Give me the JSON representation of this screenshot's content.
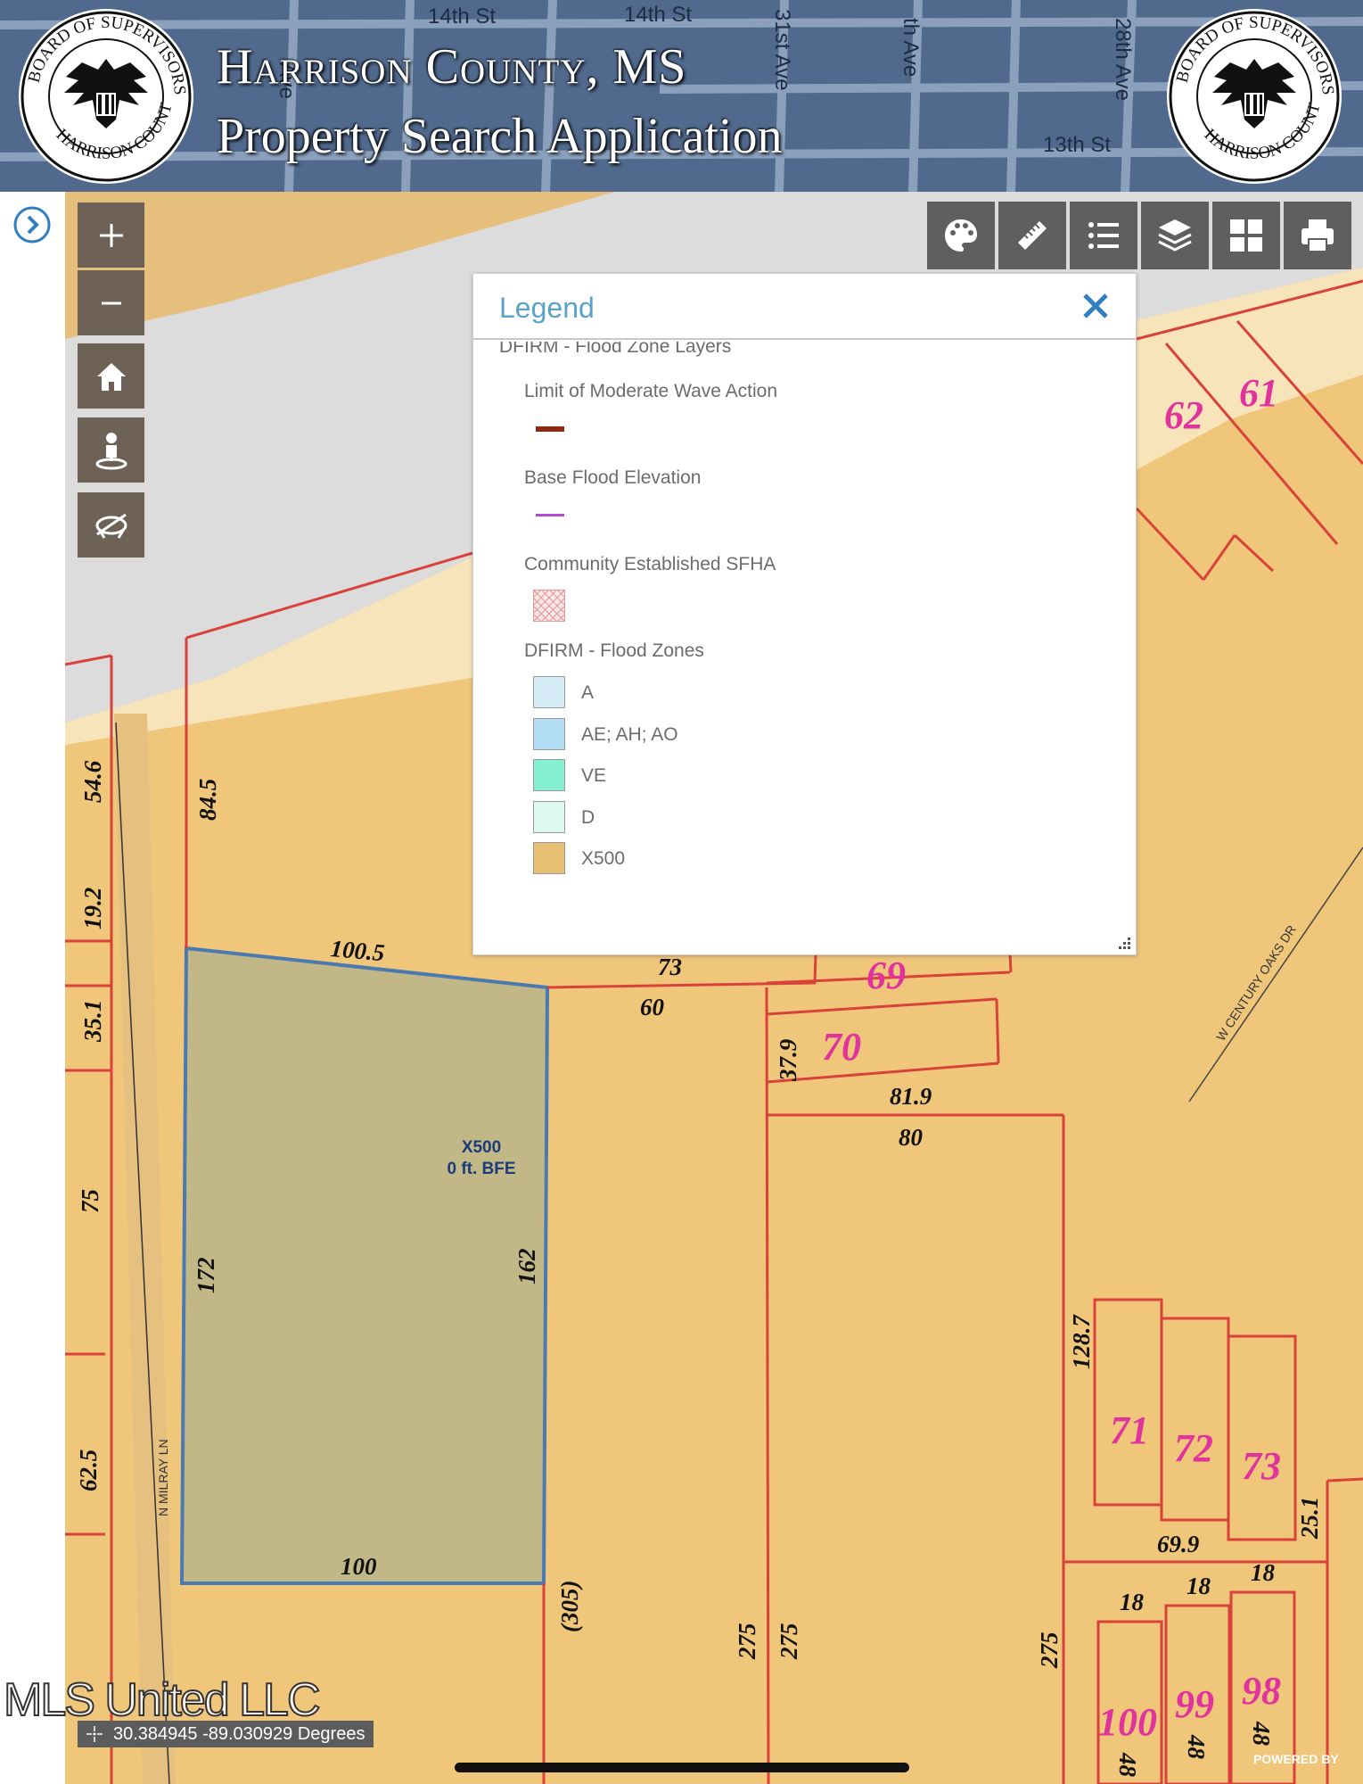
{
  "header": {
    "title_line1": "Harrison County, MS",
    "title_line2": "Property Search Application",
    "seal_text_top": "BOARD OF SUPERVISORS",
    "seal_text_bottom": "HARRISON COUNTY",
    "streets": [
      "14th St",
      "14th St",
      "14th St",
      "13th St",
      "th Ave",
      "31st Ave",
      "28th Ave",
      "Ave",
      "th Ave"
    ]
  },
  "colors": {
    "header_bg": "#50698c",
    "map_zone": "#efc67a",
    "parcel_line": "#d8423a",
    "selected_parcel": "#c1b787",
    "selected_outline": "#4a7ab0",
    "lot_number": "#e0339e",
    "legend_title": "#5aa2c7",
    "close_icon": "#2f7fc1",
    "tool_button": "#5f5f5f",
    "zoom_button": "#6e6155"
  },
  "controls": {
    "zoom_in": "+",
    "zoom_out": "−",
    "home_icon": "home-icon",
    "locate_icon": "person-location-icon",
    "hide_icon": "hide-layers-icon"
  },
  "toolbar": {
    "icons": [
      "palette-icon",
      "ruler-icon",
      "list-icon",
      "layers-icon",
      "basemap-grid-icon",
      "print-icon"
    ]
  },
  "legend": {
    "title": "Legend",
    "group": "DFIRM - Flood Zone Layers",
    "items": [
      {
        "label": "Limit of Moderate Wave Action",
        "symbol_color": "#8b2b12"
      },
      {
        "label": "Base Flood Elevation",
        "symbol_color": "#b34ad8"
      },
      {
        "label": "Community Established SFHA",
        "symbol_color": "#e89a9a"
      },
      {
        "label": "DFIRM - Flood Zones"
      }
    ],
    "zones": [
      {
        "label": "A",
        "color": "#d6ecf9"
      },
      {
        "label": "AE; AH; AO",
        "color": "#b3def5"
      },
      {
        "label": "VE",
        "color": "#86f0d2"
      },
      {
        "label": "D",
        "color": "#ddf8ef"
      },
      {
        "label": "X500",
        "color": "#e8bf72"
      }
    ]
  },
  "map": {
    "zone_label_1": "X500",
    "zone_label_2": "0 ft. BFE",
    "street_label_1": "N MILRAY LN",
    "street_label_2": "W CENTURY OAKS DR",
    "dimensions": [
      "54.6",
      "84.5",
      "19.2",
      "35.1",
      "75",
      "62.5",
      "100.5",
      "172",
      "162",
      "100",
      "73",
      "60",
      "37.9",
      "81.9",
      "80",
      "(305)",
      "275",
      "275",
      "275",
      "128.7",
      "69.9",
      "25.1",
      "18",
      "18",
      "18",
      "48",
      "48",
      "48"
    ],
    "lots": [
      "62",
      "61",
      "69",
      "70",
      "71",
      "72",
      "73",
      "100",
      "99",
      "98"
    ]
  },
  "coordinates": "30.384945 -89.030929 Degrees",
  "watermark": "MLS United LLC",
  "powered_by": "POWERED BY"
}
